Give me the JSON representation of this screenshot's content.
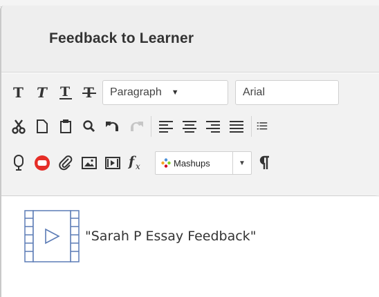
{
  "dialog": {
    "title": "Feedback to Learner"
  },
  "toolbar": {
    "row1": {
      "format_select": "Paragraph",
      "font_select": "Arial"
    },
    "row3": {
      "mashups_label": "Mashups",
      "function_label": "fx"
    }
  },
  "content": {
    "attachment_text": "\"Sarah P Essay Feedback\""
  },
  "icons": {
    "row1": [
      "bold-icon",
      "italic-icon",
      "underline-icon",
      "strikethrough-icon"
    ],
    "row2": [
      "cut-icon",
      "copy-icon",
      "paste-icon",
      "find-icon",
      "undo-icon",
      "redo-icon",
      "align-left-icon",
      "align-center-icon",
      "align-right-icon",
      "justify-icon",
      "list-icon"
    ],
    "row3": [
      "record-audio-icon",
      "youtube-icon",
      "attachment-icon",
      "image-icon",
      "media-icon",
      "formula-icon",
      "mashups-icon",
      "paragraph-mark-icon"
    ]
  },
  "colors": {
    "header_bg": "#eeeeee",
    "toolbar_bg": "#f2f2f2",
    "youtube_red": "#e52d27",
    "video_icon_blue": "#5b7bb5"
  }
}
